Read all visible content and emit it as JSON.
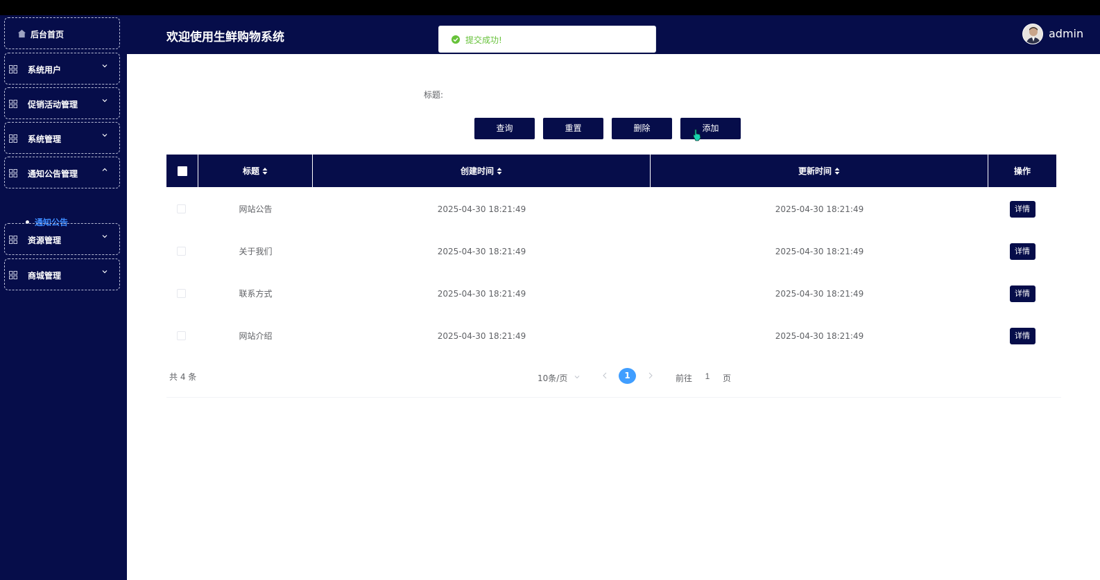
{
  "sidebar": {
    "home_label": "后台首页",
    "groups": [
      {
        "label": "系统用户"
      },
      {
        "label": "促销活动管理"
      },
      {
        "label": "系统管理"
      },
      {
        "label": "通知公告管理"
      },
      {
        "label": "资源管理"
      },
      {
        "label": "商城管理"
      }
    ],
    "sub_item_label": "通知公告"
  },
  "header": {
    "title": "欢迎使用生鲜购物系统",
    "username": "admin"
  },
  "toast": {
    "message": "提交成功!"
  },
  "search": {
    "title_label": "标题:",
    "title_value": ""
  },
  "buttons": {
    "query": "查询",
    "reset": "重置",
    "delete": "删除",
    "add": "添加"
  },
  "table": {
    "columns": {
      "title": "标题",
      "created": "创建时间",
      "updated": "更新时间",
      "actions": "操作"
    },
    "rows": [
      {
        "title": "网站公告",
        "created": "2025-04-30 18:21:49",
        "updated": "2025-04-30 18:21:49",
        "action": "详情"
      },
      {
        "title": "关于我们",
        "created": "2025-04-30 18:21:49",
        "updated": "2025-04-30 18:21:49",
        "action": "详情"
      },
      {
        "title": "联系方式",
        "created": "2025-04-30 18:21:49",
        "updated": "2025-04-30 18:21:49",
        "action": "详情"
      },
      {
        "title": "网站介绍",
        "created": "2025-04-30 18:21:49",
        "updated": "2025-04-30 18:21:49",
        "action": "详情"
      }
    ]
  },
  "pager": {
    "total": "共 4 条",
    "page_size": "10条/页",
    "current_page": "1",
    "goto_label": "前往",
    "goto_value": "1",
    "page_unit": "页"
  },
  "colors": {
    "navy": "#060d4a",
    "accent_blue": "#409eff",
    "success_green": "#67c23a"
  },
  "icons": {
    "home": "home-icon",
    "menu": "grid-icon",
    "expand": "chevron-down-icon",
    "collapse": "chevron-up-icon",
    "toast": "check-circle-icon",
    "sort": "sort-icon"
  }
}
